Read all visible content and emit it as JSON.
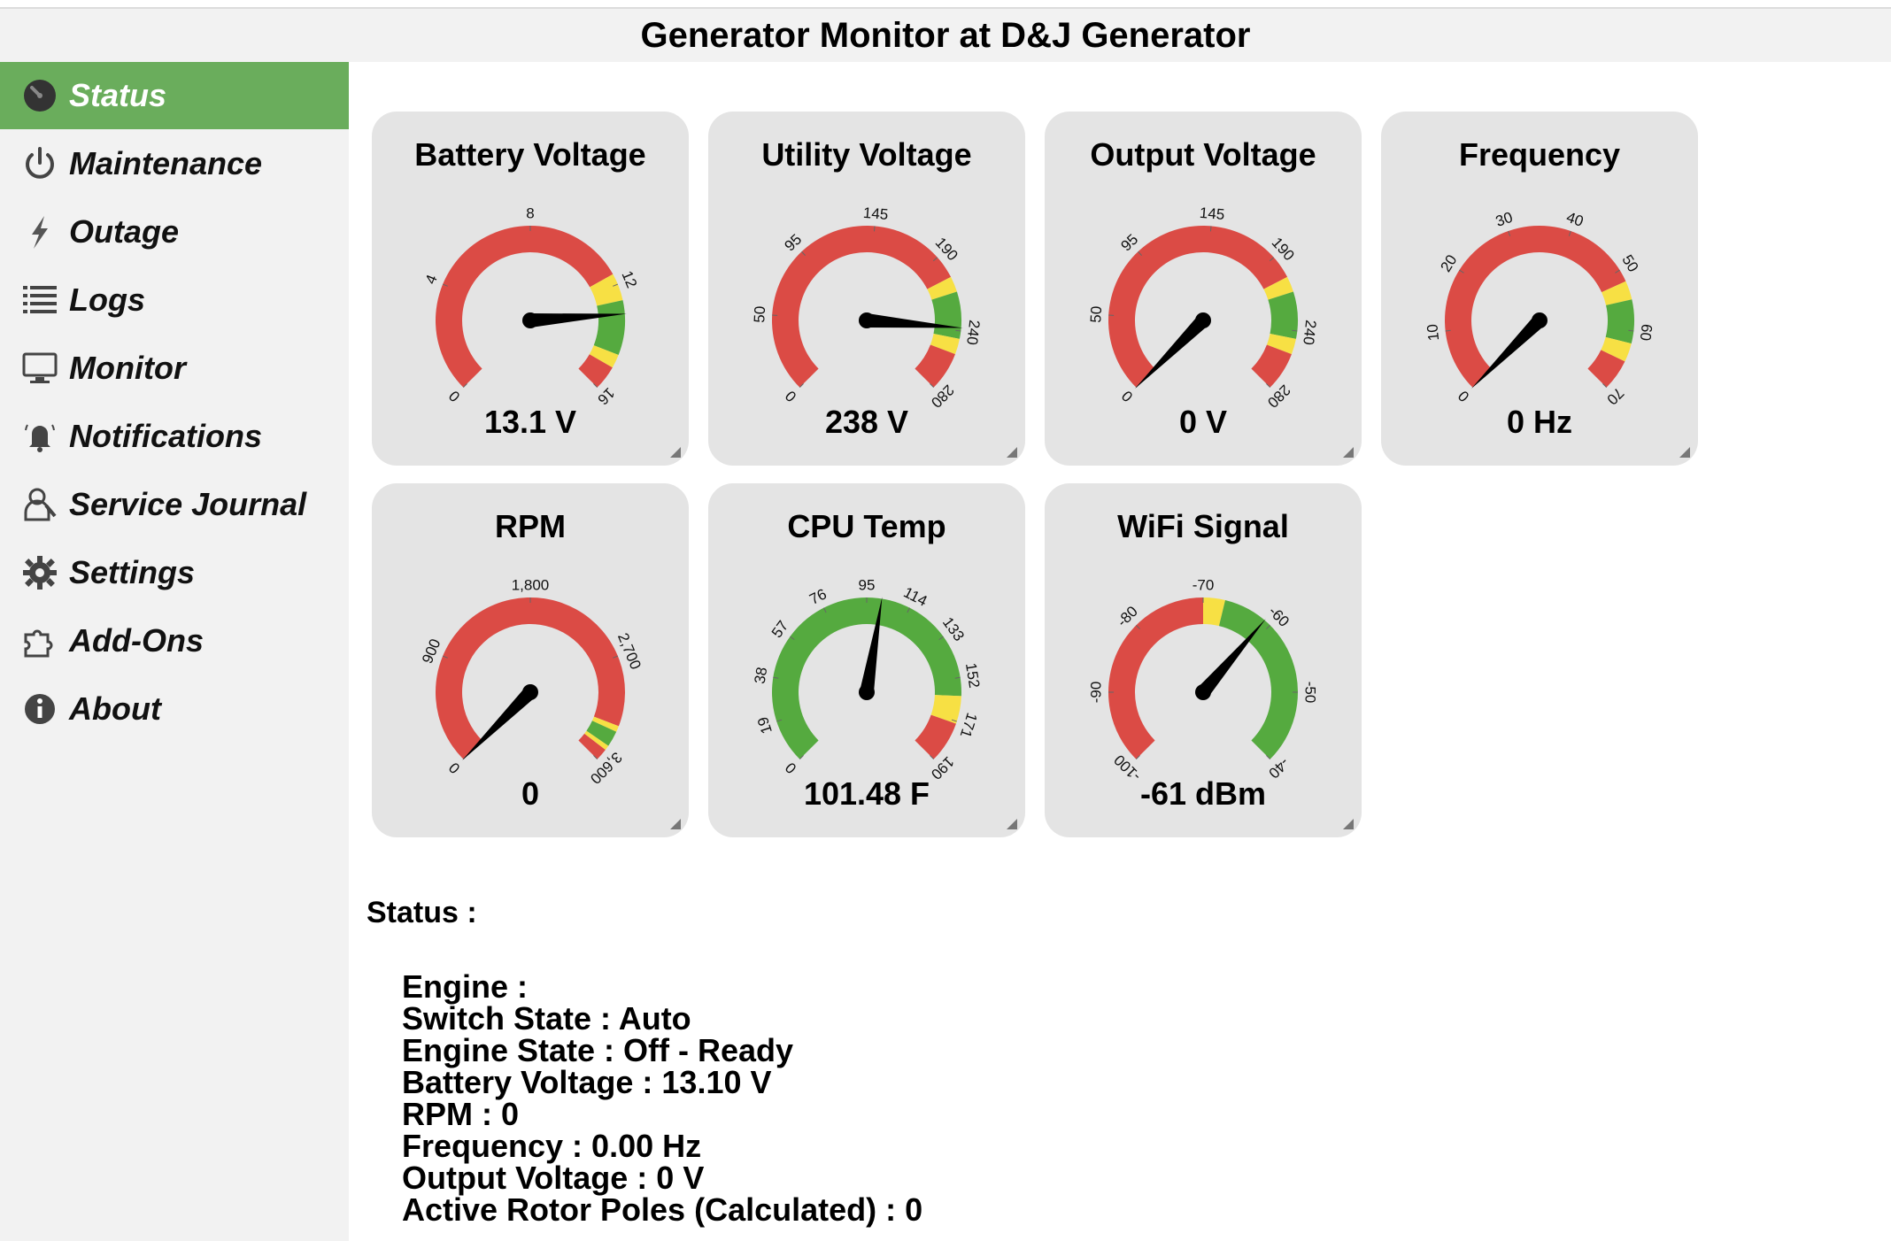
{
  "title": "Generator Monitor at D&J Generator",
  "nav": [
    {
      "label": "Status",
      "icon": "gauge-icon",
      "active": true
    },
    {
      "label": "Maintenance",
      "icon": "power-icon",
      "active": false
    },
    {
      "label": "Outage",
      "icon": "lightning-icon",
      "active": false
    },
    {
      "label": "Logs",
      "icon": "list-icon",
      "active": false
    },
    {
      "label": "Monitor",
      "icon": "monitor-icon",
      "active": false
    },
    {
      "label": "Notifications",
      "icon": "bell-icon",
      "active": false
    },
    {
      "label": "Service Journal",
      "icon": "mechanic-icon",
      "active": false
    },
    {
      "label": "Settings",
      "icon": "gear-icon",
      "active": false
    },
    {
      "label": "Add-Ons",
      "icon": "puzzle-icon",
      "active": false
    },
    {
      "label": "About",
      "icon": "info-icon",
      "active": false
    }
  ],
  "colors": {
    "red": "#db4b45",
    "yellow": "#f7e044",
    "green": "#55aa3f",
    "active_nav": "#6aad5c",
    "tile": "#e4e4e4"
  },
  "gauges": [
    {
      "name": "battery-voltage",
      "title": "Battery Voltage",
      "value_text": "13.1 V",
      "min": 0,
      "max": 16,
      "value": 13.1,
      "ticks": [
        "0",
        "4",
        "8",
        "12",
        "16"
      ],
      "tick_values": [
        0,
        4,
        8,
        12,
        16
      ],
      "bands": [
        {
          "from": 0,
          "to": 11.6,
          "color": "red"
        },
        {
          "from": 11.6,
          "to": 12.6,
          "color": "yellow"
        },
        {
          "from": 12.6,
          "to": 14.6,
          "color": "green"
        },
        {
          "from": 14.6,
          "to": 15.1,
          "color": "yellow"
        },
        {
          "from": 15.1,
          "to": 16,
          "color": "red"
        }
      ]
    },
    {
      "name": "utility-voltage",
      "title": "Utility Voltage",
      "value_text": "238 V",
      "min": 0,
      "max": 280,
      "value": 238,
      "ticks": [
        "0",
        "50",
        "95",
        "145",
        "190",
        "240",
        "280"
      ],
      "tick_values": [
        0,
        50,
        95,
        145,
        190,
        240,
        280
      ],
      "bands": [
        {
          "from": 0,
          "to": 205,
          "color": "red"
        },
        {
          "from": 205,
          "to": 215,
          "color": "yellow"
        },
        {
          "from": 215,
          "to": 245,
          "color": "green"
        },
        {
          "from": 245,
          "to": 255,
          "color": "yellow"
        },
        {
          "from": 255,
          "to": 280,
          "color": "red"
        }
      ]
    },
    {
      "name": "output-voltage",
      "title": "Output Voltage",
      "value_text": "0 V",
      "min": 0,
      "max": 280,
      "value": 0,
      "ticks": [
        "0",
        "50",
        "95",
        "145",
        "190",
        "240",
        "280"
      ],
      "tick_values": [
        0,
        50,
        95,
        145,
        190,
        240,
        280
      ],
      "bands": [
        {
          "from": 0,
          "to": 205,
          "color": "red"
        },
        {
          "from": 205,
          "to": 215,
          "color": "yellow"
        },
        {
          "from": 215,
          "to": 245,
          "color": "green"
        },
        {
          "from": 245,
          "to": 255,
          "color": "yellow"
        },
        {
          "from": 255,
          "to": 280,
          "color": "red"
        }
      ]
    },
    {
      "name": "frequency",
      "title": "Frequency",
      "value_text": "0 Hz",
      "min": 0,
      "max": 70,
      "value": 0,
      "ticks": [
        "0",
        "10",
        "20",
        "30",
        "40",
        "50",
        "60",
        "70"
      ],
      "tick_values": [
        10,
        20,
        30,
        40,
        50,
        60,
        70
      ],
      "bands": [
        {
          "from": 0,
          "to": 52,
          "color": "red"
        },
        {
          "from": 52,
          "to": 55,
          "color": "yellow"
        },
        {
          "from": 55,
          "to": 62,
          "color": "green"
        },
        {
          "from": 62,
          "to": 65,
          "color": "yellow"
        },
        {
          "from": 65,
          "to": 70,
          "color": "red"
        }
      ]
    },
    {
      "name": "rpm",
      "title": "RPM",
      "value_text": "0",
      "min": 0,
      "max": 3600,
      "value": 0,
      "ticks": [
        "0",
        "900",
        "1,800",
        "2,700",
        "3,600"
      ],
      "tick_values": [
        0,
        900,
        1800,
        2700,
        3600
      ],
      "bands": [
        {
          "from": 0,
          "to": 3280,
          "color": "red"
        },
        {
          "from": 3280,
          "to": 3330,
          "color": "yellow"
        },
        {
          "from": 3330,
          "to": 3460,
          "color": "green"
        },
        {
          "from": 3460,
          "to": 3500,
          "color": "yellow"
        },
        {
          "from": 3500,
          "to": 3600,
          "color": "red"
        }
      ]
    },
    {
      "name": "cpu-temp",
      "title": "CPU Temp",
      "value_text": "101.48 F",
      "min": 0,
      "max": 190,
      "value": 101.48,
      "ticks": [
        "0",
        "19",
        "38",
        "57",
        "76",
        "95",
        "114",
        "133",
        "152",
        "171",
        "190"
      ],
      "tick_values": [
        0,
        19,
        38,
        57,
        76,
        95,
        114,
        133,
        152,
        171,
        190
      ],
      "bands": [
        {
          "from": 0,
          "to": 160,
          "color": "green"
        },
        {
          "from": 160,
          "to": 172,
          "color": "yellow"
        },
        {
          "from": 172,
          "to": 190,
          "color": "red"
        }
      ]
    },
    {
      "name": "wifi-signal",
      "title": "WiFi Signal",
      "value_text": "-61 dBm",
      "min": -100,
      "max": -40,
      "value": -61,
      "ticks": [
        "-100",
        "-90",
        "-80",
        "-70",
        "-60",
        "-50",
        "-40"
      ],
      "tick_values": [
        -100,
        -90,
        -80,
        -70,
        -60,
        -50,
        -40
      ],
      "bands": [
        {
          "from": -100,
          "to": -70,
          "color": "red"
        },
        {
          "from": -70,
          "to": -67,
          "color": "yellow"
        },
        {
          "from": -67,
          "to": -40,
          "color": "green"
        }
      ]
    }
  ],
  "status": {
    "heading": "Status :",
    "sections": [
      {
        "title": "Engine :",
        "lines": [
          "Switch State : Auto",
          "Engine State : Off - Ready",
          "Battery Voltage : 13.10 V",
          "RPM : 0",
          "Frequency : 0.00 Hz",
          "Output Voltage : 0 V",
          "Active Rotor Poles (Calculated) : 0"
        ]
      }
    ]
  }
}
